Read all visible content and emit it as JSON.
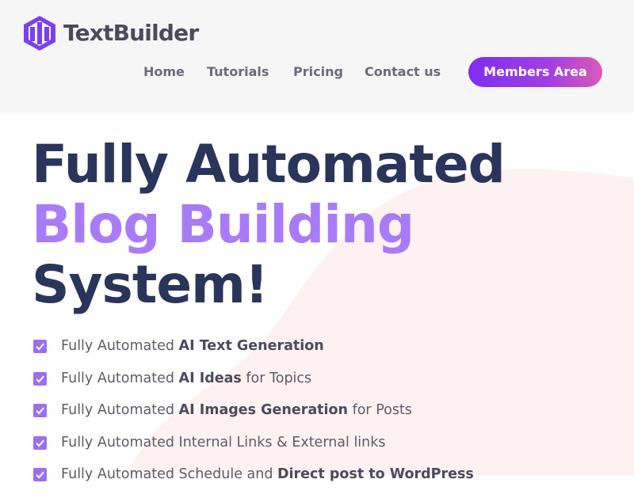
{
  "brand": {
    "name": "TextBuilder",
    "primary": "#8b3cf0",
    "heading": "#29355a",
    "accent": "#a87cf7"
  },
  "nav": {
    "items": [
      "Home",
      "Tutorials",
      "Pricing",
      "Contact us"
    ],
    "cta": "Members Area"
  },
  "hero": {
    "line1": "Fully Automated",
    "line2": "Blog Building",
    "line3": "System!"
  },
  "features": [
    {
      "pre": "Fully Automated ",
      "bold": "AI Text Generation",
      "post": ""
    },
    {
      "pre": "Fully Automated ",
      "bold": "AI Ideas",
      "post": " for Topics"
    },
    {
      "pre": "Fully Automated ",
      "bold": "AI Images Generation",
      "post": " for Posts"
    },
    {
      "pre": "Fully Automated Internal Links & External links",
      "bold": "",
      "post": ""
    },
    {
      "pre": "Fully Automated Schedule and ",
      "bold": "Direct post to WordPress",
      "post": ""
    }
  ],
  "icons": {
    "logo": "textbuilder-logo-icon",
    "check": "checkbox-checked-icon"
  }
}
